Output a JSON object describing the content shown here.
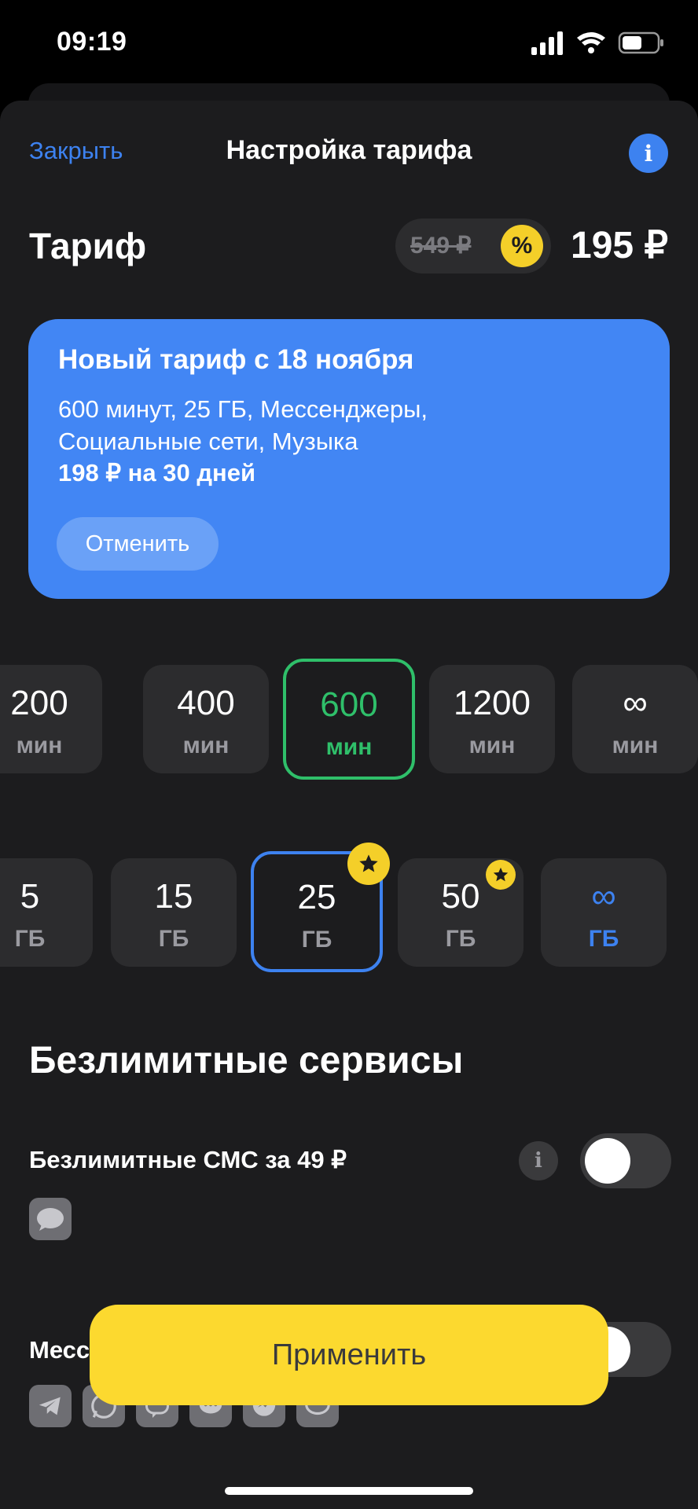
{
  "status_bar": {
    "time": "09:19"
  },
  "header": {
    "close_label": "Закрыть",
    "title": "Настройка тарифа",
    "info_glyph": "i"
  },
  "tariff": {
    "title": "Тариф",
    "old_price": "549 ₽",
    "discount_glyph": "%",
    "new_price": "195 ₽"
  },
  "promo": {
    "title": "Новый тариф с 18 ноября",
    "description_line1": "600 минут, 25 ГБ, Мессенджеры,",
    "description_line2": "Социальные сети, Музыка",
    "price": "198 ₽ на 30 дней",
    "cancel_label": "Отменить"
  },
  "minutes": {
    "unit": "мин",
    "options": [
      {
        "value": "200"
      },
      {
        "value": "400"
      },
      {
        "value": "600",
        "selected": true
      },
      {
        "value": "1200"
      },
      {
        "value": "∞"
      }
    ]
  },
  "gigabytes": {
    "unit": "ГБ",
    "options": [
      {
        "value": "5"
      },
      {
        "value": "15"
      },
      {
        "value": "25",
        "selected": true,
        "star": true
      },
      {
        "value": "50",
        "star": true
      },
      {
        "value": "∞"
      }
    ]
  },
  "services": {
    "title": "Безлимитные сервисы",
    "sms_label": "Безлимитные СМС за  49 ₽",
    "sms_info_glyph": "i",
    "messengers_label": "Месс"
  },
  "apply_label": "Применить",
  "colors": {
    "accent_blue": "#4286f4",
    "selected_green": "#2fbf6a",
    "yellow": "#fcd92f"
  }
}
